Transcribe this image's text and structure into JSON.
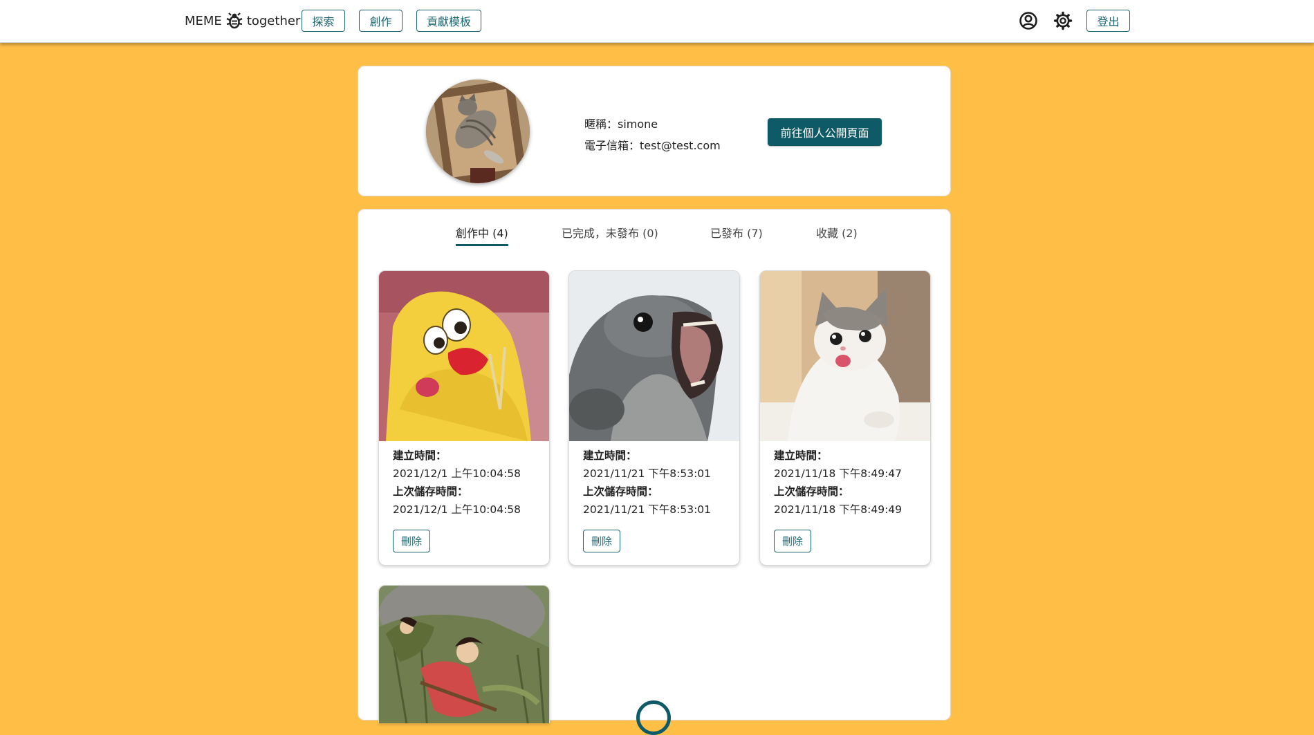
{
  "nav": {
    "brand_left": "MEME",
    "brand_right": "together",
    "brand_icon": "bug-icon",
    "explore_label": "探索",
    "create_label": "創作",
    "contribute_label": "貢獻模板",
    "profile_icon": "user-circle-icon",
    "settings_icon": "gear-icon",
    "logout_label": "登出"
  },
  "profile": {
    "nickname_line": "暱稱：simone",
    "email_line": "電子信箱：test@test.com",
    "public_page_label": "前往個人公開頁面"
  },
  "tabs": [
    {
      "label": "創作中 (4)",
      "active": true
    },
    {
      "label": "已完成，未發布 (0)",
      "active": false
    },
    {
      "label": "已發布 (7)",
      "active": false
    },
    {
      "label": "收藏 (2)",
      "active": false
    }
  ],
  "cards": [
    {
      "image": "yellow-plush-chick-meme",
      "created_label": "建立時間：",
      "created_value": "2021/12/1 上午10:04:58",
      "saved_label": "上次儲存時間：",
      "saved_value": "2021/12/1 上午10:04:58",
      "delete_label": "刪除"
    },
    {
      "image": "yelling-seal-meme",
      "created_label": "建立時間：",
      "created_value": "2021/11/21 下午8:53:01",
      "saved_label": "上次儲存時間：",
      "saved_value": "2021/11/21 下午8:53:01",
      "delete_label": "刪除"
    },
    {
      "image": "surprised-cat-meme",
      "created_label": "建立時間：",
      "created_value": "2021/11/18 下午8:49:47",
      "saved_label": "上次儲存時間：",
      "saved_value": "2021/11/18 下午8:49:49",
      "delete_label": "刪除"
    },
    {
      "image": "anime-characters-meme"
    }
  ],
  "colors": {
    "page_bg": "#ffbf47",
    "accent": "#0e5b67",
    "outline": "#1a6571"
  }
}
